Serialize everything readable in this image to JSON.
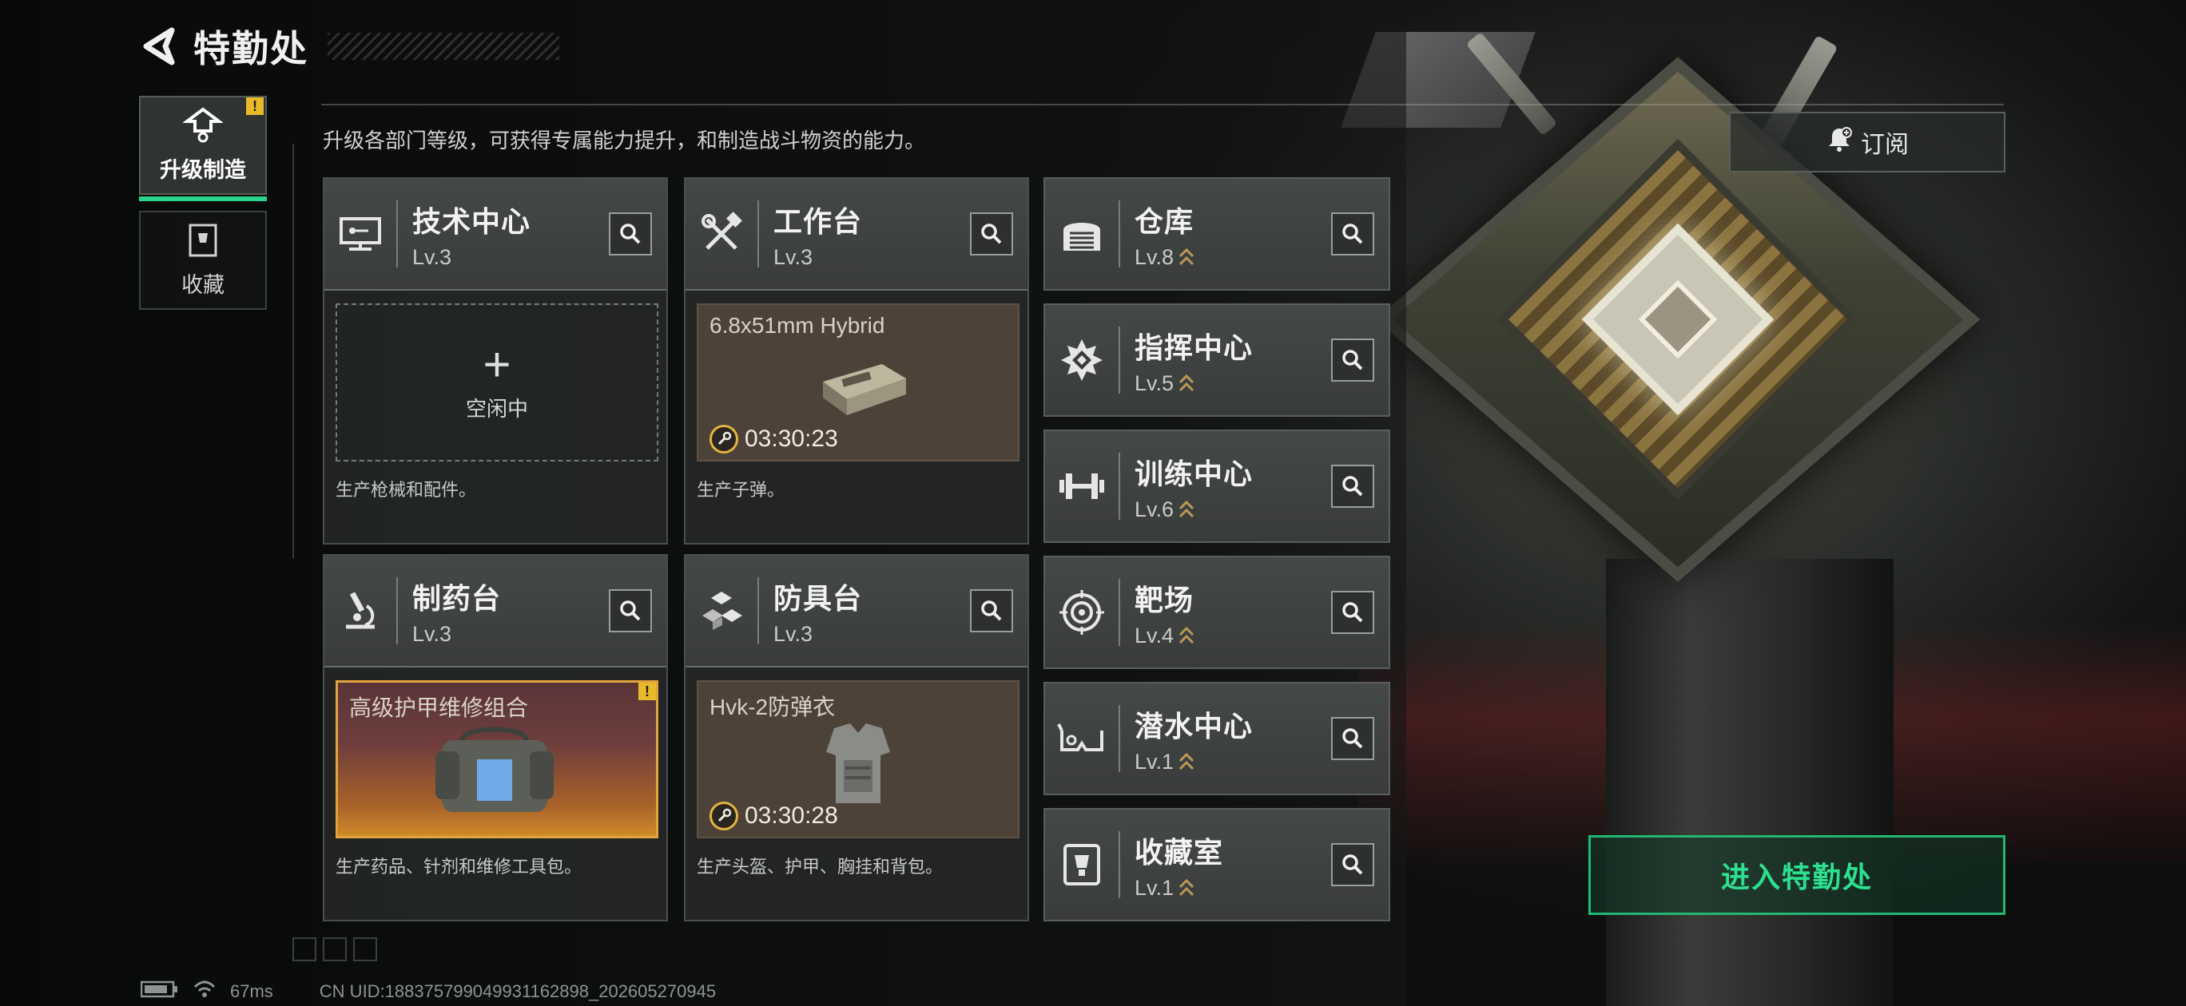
{
  "header": {
    "title": "特勤处"
  },
  "side_tabs": [
    {
      "label": "升级制造",
      "badge": "!"
    },
    {
      "label": "收藏"
    }
  ],
  "description": "升级各部门等级，可获得专属能力提升，和制造战斗物资的能力。",
  "subscribe_label": "订阅",
  "enter_label": "进入特勤处",
  "stations": {
    "tech": {
      "name": "技术中心",
      "level": "Lv.3",
      "slot_plus": "+",
      "slot_status": "空闲中",
      "caption": "生产枪械和配件。"
    },
    "workbench": {
      "name": "工作台",
      "level": "Lv.3",
      "item": "6.8x51mm Hybrid",
      "timer": "03:30:23",
      "caption": "生产子弹。"
    },
    "pharmacy": {
      "name": "制药台",
      "level": "Lv.3",
      "item": "高级护甲维修组合",
      "badge": "!",
      "caption": "生产药品、针剂和维修工具包。"
    },
    "armor": {
      "name": "防具台",
      "level": "Lv.3",
      "item": "Hvk-2防弹衣",
      "timer": "03:30:28",
      "caption": "生产头盔、护甲、胸挂和背包。"
    }
  },
  "right_stations": [
    {
      "name": "仓库",
      "level": "Lv.8"
    },
    {
      "name": "指挥中心",
      "level": "Lv.5"
    },
    {
      "name": "训练中心",
      "level": "Lv.6"
    },
    {
      "name": "靶场",
      "level": "Lv.4"
    },
    {
      "name": "潜水中心",
      "level": "Lv.1"
    },
    {
      "name": "收藏室",
      "level": "Lv.1"
    }
  ],
  "status": {
    "ping": "67ms",
    "uid": "CN UID:18837579904993116​2898_202605270945"
  },
  "colors": {
    "accent_green": "#29d38a",
    "warning_yellow": "#e8b92a",
    "timer_gold": "#e2b440"
  },
  "icons": {
    "back": "back-arrow-icon",
    "search": "magnifier-icon",
    "subscribe": "bell-plus-icon",
    "tech": "monitor-circuit-icon",
    "workbench": "hammer-wrench-icon",
    "pharmacy": "microscope-icon",
    "armor": "cubes-icon",
    "warehouse": "garage-door-icon",
    "command": "compass-gear-icon",
    "training": "dumbbell-icon",
    "range": "target-icon",
    "diving": "diving-mask-icon",
    "collection": "trophy-box-icon"
  }
}
